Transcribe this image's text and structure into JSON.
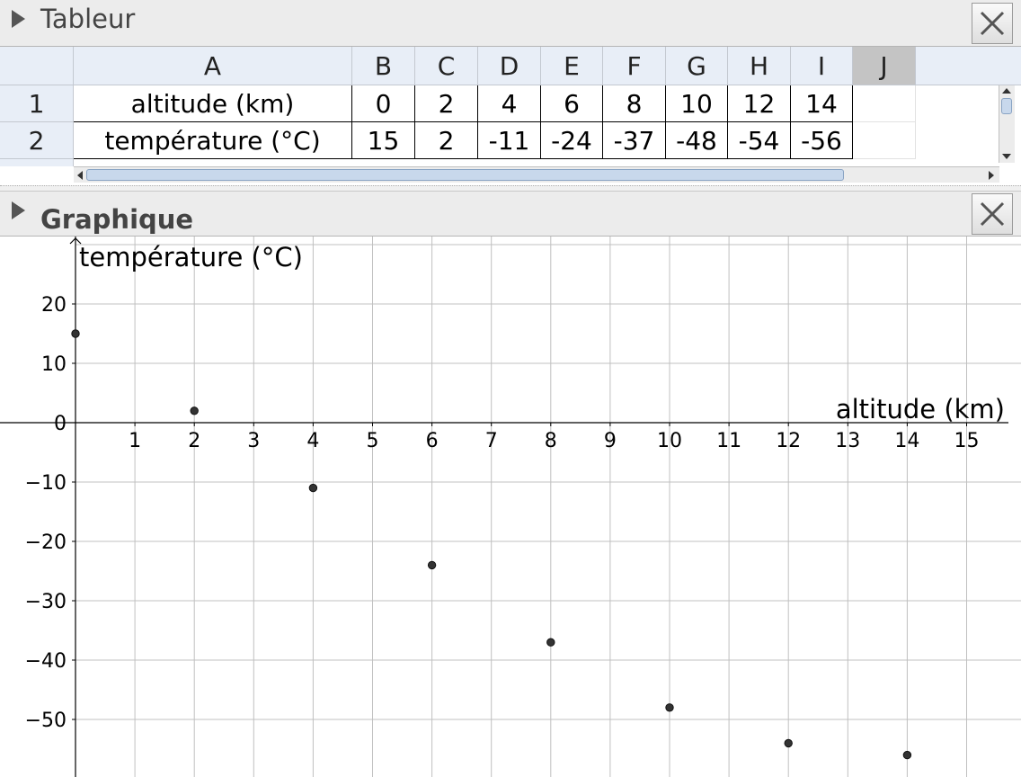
{
  "spreadsheet": {
    "title": "Tableur",
    "columns": [
      "A",
      "B",
      "C",
      "D",
      "E",
      "F",
      "G",
      "H",
      "I",
      "J"
    ],
    "selected_column": "J",
    "rows": [
      {
        "row_label": "1",
        "cells": [
          "altitude (km)",
          "0",
          "2",
          "4",
          "6",
          "8",
          "10",
          "12",
          "14"
        ]
      },
      {
        "row_label": "2",
        "cells": [
          "température (°C)",
          "15",
          "2",
          "-11",
          "-24",
          "-37",
          "-48",
          "-54",
          "-56"
        ]
      }
    ]
  },
  "graph": {
    "title": "Graphique",
    "icons": {
      "toggle": "triangle-right-icon",
      "close": "close-x-icon"
    }
  },
  "chart_data": {
    "type": "scatter",
    "xlabel": "altitude (km)",
    "ylabel": "température (°C)",
    "x_ticks": [
      "1",
      "2",
      "3",
      "4",
      "5",
      "6",
      "7",
      "8",
      "9",
      "10",
      "11",
      "12",
      "13",
      "14",
      "15"
    ],
    "y_ticks": [
      "20",
      "10",
      "0",
      "−10",
      "−20",
      "−30",
      "−40",
      "−50"
    ],
    "xlim": [
      0,
      15.6
    ],
    "ylim": [
      -59,
      31
    ],
    "grid": true,
    "x": [
      0,
      2,
      4,
      6,
      8,
      10,
      12,
      14
    ],
    "y": [
      15,
      2,
      -11,
      -24,
      -37,
      -48,
      -54,
      -56
    ],
    "point_color": "#333333",
    "grid_color": "#c0c0c0"
  }
}
